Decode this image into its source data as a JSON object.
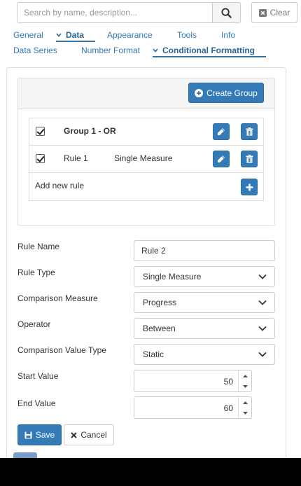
{
  "search": {
    "placeholder": "Search by name, description...",
    "value": "",
    "icon": "search-icon"
  },
  "clear_button": {
    "label": "Clear",
    "icon": "close-box-icon"
  },
  "tabs_primary": [
    {
      "label": "General",
      "active": false
    },
    {
      "label": "Data",
      "active": true
    },
    {
      "label": "Appearance",
      "active": false
    },
    {
      "label": "Tools",
      "active": false
    },
    {
      "label": "Info",
      "active": false
    }
  ],
  "tabs_secondary": [
    {
      "label": "Data Series",
      "active": false
    },
    {
      "label": "Number Format",
      "active": false
    },
    {
      "label": "Conditional Formatting",
      "active": true
    }
  ],
  "groups": {
    "create_label": "Create Group",
    "group_row": {
      "checked": true,
      "title": "Group 1 - OR"
    },
    "rule_row": {
      "checked": true,
      "name": "Rule 1",
      "type": "Single Measure"
    },
    "add_rule_label": "Add new rule"
  },
  "form": {
    "rule_name_label": "Rule Name",
    "rule_name_value": "Rule 2",
    "rule_type_label": "Rule Type",
    "rule_type_value": "Single Measure",
    "comparison_measure_label": "Comparison Measure",
    "comparison_measure_value": "Progress",
    "operator_label": "Operator",
    "operator_value": "Between",
    "comparison_value_type_label": "Comparison Value Type",
    "comparison_value_type_value": "Static",
    "start_value_label": "Start Value",
    "start_value": "50",
    "end_value_label": "End Value",
    "end_value": "60"
  },
  "actions": {
    "save_label": "Save",
    "cancel_label": "Cancel"
  },
  "colors": {
    "primary": "#337ab7",
    "border": "#cccccc",
    "panel_header": "#f5f5f5"
  }
}
